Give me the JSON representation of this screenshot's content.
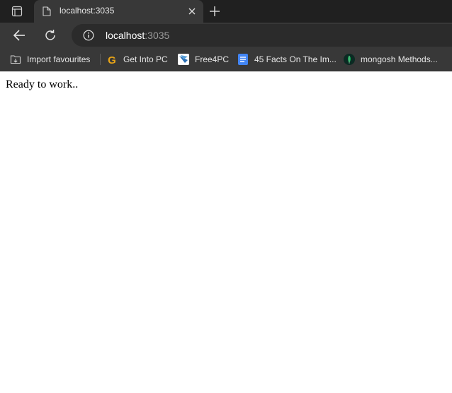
{
  "tab": {
    "title": "localhost:3035"
  },
  "toolbar": {
    "url_host": "localhost",
    "url_port": ":3035"
  },
  "favourites": [
    {
      "label": "Import favourites",
      "icon": "import-favourites-icon"
    },
    {
      "label": "Get Into PC",
      "icon": "getintopc-favicon"
    },
    {
      "label": "Free4PC",
      "icon": "free4pc-favicon"
    },
    {
      "label": "45 Facts On The Im...",
      "icon": "docs-favicon"
    },
    {
      "label": "mongosh Methods...",
      "icon": "mongodb-favicon"
    }
  ],
  "page": {
    "text": "Ready to work.."
  },
  "colors": {
    "tabstrip_bg": "#202020",
    "toolbar_bg": "#383838",
    "omnibox_bg": "#2b2b2b",
    "page_bg": "#ffffff"
  }
}
